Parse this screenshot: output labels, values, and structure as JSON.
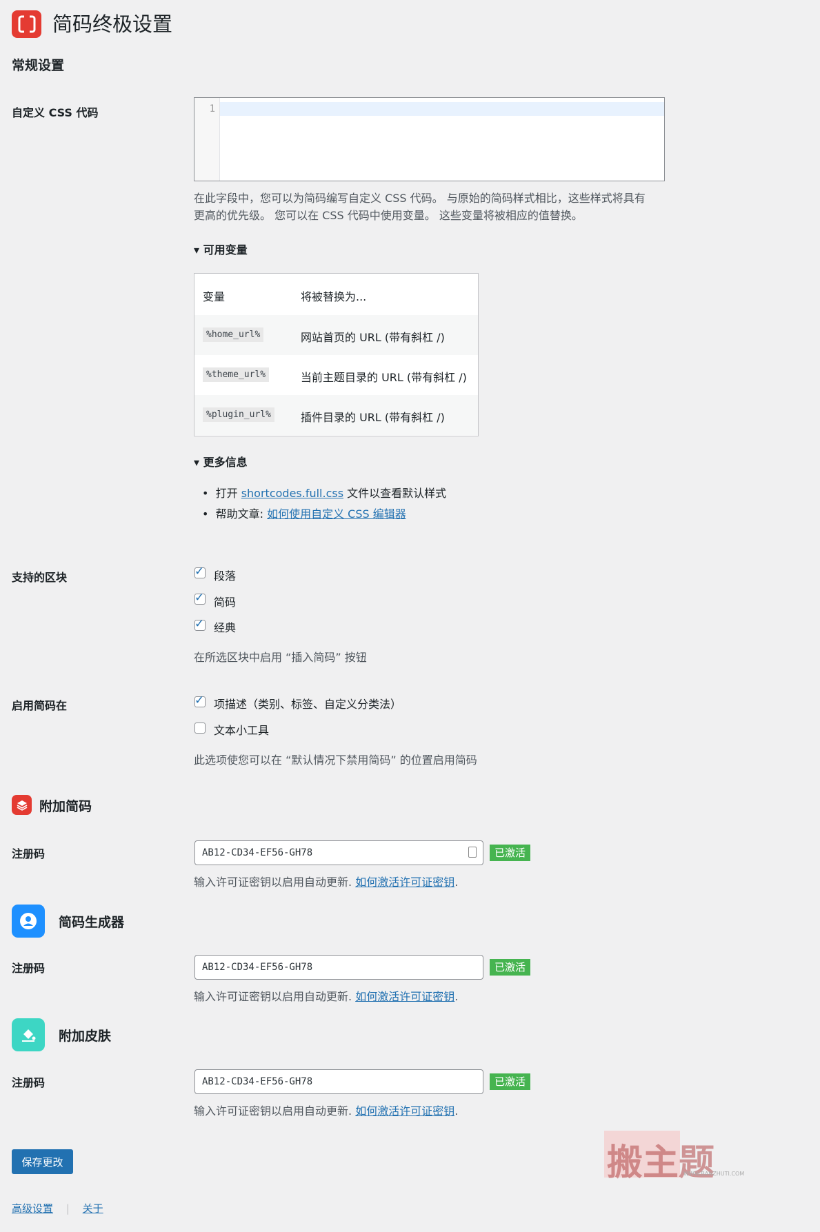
{
  "page": {
    "title": "简码终极设置"
  },
  "general": {
    "heading": "常规设置",
    "custom_css": {
      "label": "自定义 CSS 代码",
      "line_number": "1",
      "description_line1": "在此字段中，您可以为简码编写自定义 CSS 代码。 与原始的简码样式相比，这些样式将具有",
      "description_line2": "更高的优先级。 您可以在 CSS 代码中使用变量。 这些变量将被相应的值替换。"
    },
    "available_vars": {
      "summary": "▾ 可用变量",
      "header_var": "变量",
      "header_replace": "将被替换为...",
      "rows": [
        {
          "var": "%home_url%",
          "desc": "网站首页的 URL (带有斜杠 /)"
        },
        {
          "var": "%theme_url%",
          "desc": "当前主题目录的 URL (带有斜杠 /)"
        },
        {
          "var": "%plugin_url%",
          "desc": "插件目录的 URL (带有斜杠 /)"
        }
      ]
    },
    "more_info": {
      "summary": "▾ 更多信息",
      "item1_prefix": "打开 ",
      "item1_link": "shortcodes.full.css",
      "item1_suffix": " 文件以查看默认样式",
      "item2_prefix": "帮助文章: ",
      "item2_link": "如何使用自定义 CSS 编辑器"
    },
    "supported_blocks": {
      "label": "支持的区块",
      "options": [
        {
          "label": "段落",
          "checked": true
        },
        {
          "label": "简码",
          "checked": true
        },
        {
          "label": "经典",
          "checked": true
        }
      ],
      "description": "在所选区块中启用 “插入简码” 按钮"
    },
    "enable_in": {
      "label": "启用简码在",
      "options": [
        {
          "label": "项描述（类别、标签、自定义分类法）",
          "checked": true
        },
        {
          "label": "文本小工具",
          "checked": false
        }
      ],
      "description": "此选项使您可以在 “默认情况下禁用简码” 的位置启用简码"
    }
  },
  "addons": [
    {
      "title": "附加简码",
      "key_label": "注册码",
      "key_value": "AB12-CD34-EF56-GH78",
      "badge": "已激活",
      "help_prefix": "输入许可证密钥以启用自动更新. ",
      "help_link": "如何激活许可证密钥",
      "help_suffix": "."
    },
    {
      "title": "简码生成器",
      "key_label": "注册码",
      "key_value": "AB12-CD34-EF56-GH78",
      "badge": "已激活",
      "help_prefix": "输入许可证密钥以启用自动更新. ",
      "help_link": "如何激活许可证密钥",
      "help_suffix": "."
    },
    {
      "title": "附加皮肤",
      "key_label": "注册码",
      "key_value": "AB12-CD34-EF56-GH78",
      "badge": "已激活",
      "help_prefix": "输入许可证密钥以启用自动更新. ",
      "help_link": "如何激活许可证密钥",
      "help_suffix": "."
    }
  ],
  "footer": {
    "save_button": "保存更改",
    "advanced_link": "高级设置",
    "separator": "|",
    "about_link": "关于"
  },
  "watermark": {
    "main": "搬主题",
    "url": "WWW.BANZHUTI.COM"
  },
  "colors": {
    "brand_red": "#e43b32",
    "link_blue": "#2271b1",
    "badge_green": "#46b450"
  }
}
